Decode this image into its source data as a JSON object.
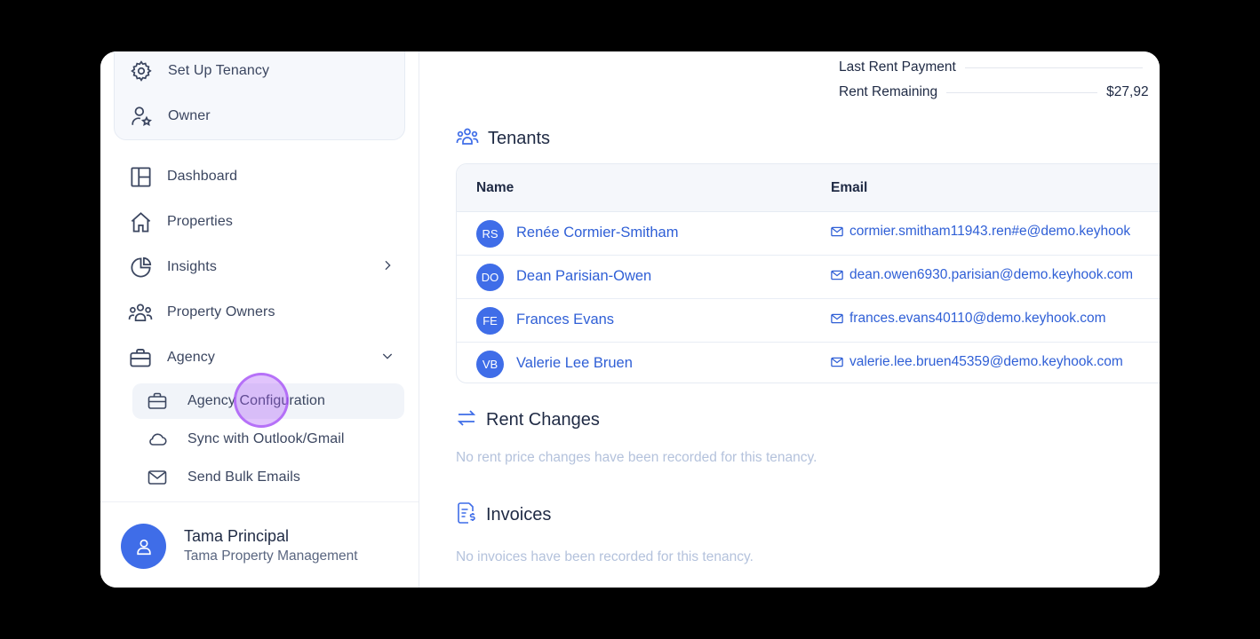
{
  "sidebar": {
    "top_items": [
      {
        "label": "Set Up Tenancy",
        "icon": "gear-icon"
      },
      {
        "label": "Owner",
        "icon": "user-star-icon"
      }
    ],
    "items": [
      {
        "label": "Dashboard",
        "icon": "layout-icon"
      },
      {
        "label": "Properties",
        "icon": "house-icon"
      },
      {
        "label": "Insights",
        "icon": "pie-chart-icon"
      },
      {
        "label": "Property Owners",
        "icon": "users-icon"
      },
      {
        "label": "Agency",
        "icon": "briefcase-icon"
      }
    ],
    "sub_items": [
      {
        "label": "Agency Configuration",
        "icon": "briefcase-icon"
      },
      {
        "label": "Sync with Outlook/Gmail",
        "icon": "cloud-icon"
      },
      {
        "label": "Send Bulk Emails",
        "icon": "mail-icon"
      }
    ],
    "user": {
      "name": "Tama Principal",
      "org": "Tama Property Management"
    }
  },
  "main": {
    "summary": [
      {
        "label": "Last Rent Payment",
        "value": ""
      },
      {
        "label": "Rent Remaining",
        "value": "$27,92"
      }
    ],
    "tenants": {
      "title": "Tenants",
      "headers": {
        "name": "Name",
        "email": "Email"
      },
      "rows": [
        {
          "initials": "RS",
          "name": "Renée Cormier-Smitham",
          "email": "cormier.smitham11943.ren#e@demo.keyhook"
        },
        {
          "initials": "DO",
          "name": "Dean Parisian-Owen",
          "email": "dean.owen6930.parisian@demo.keyhook.com"
        },
        {
          "initials": "FE",
          "name": "Frances Evans",
          "email": "frances.evans40110@demo.keyhook.com"
        },
        {
          "initials": "VB",
          "name": "Valerie Lee Bruen",
          "email": "valerie.lee.bruen45359@demo.keyhook.com"
        }
      ]
    },
    "rent_changes": {
      "title": "Rent Changes",
      "empty": "No rent price changes have been recorded for this tenancy."
    },
    "invoices": {
      "title": "Invoices",
      "empty": "No invoices have been recorded for this tenancy."
    }
  },
  "colors": {
    "accent": "#3f6de8",
    "link": "#2f5fd6",
    "muted": "#b4c2dc"
  }
}
